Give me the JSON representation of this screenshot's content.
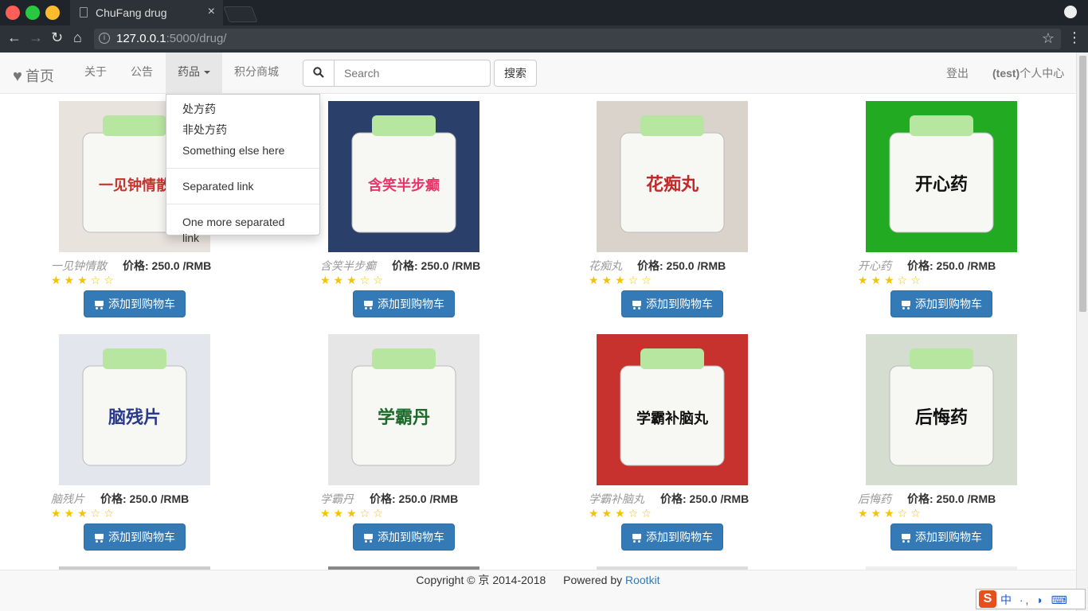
{
  "browser": {
    "tab_title": "ChuFang drug",
    "close_glyph": "×",
    "url_host": "127.0.0.1",
    "url_path": ":5000/drug/",
    "colors": {
      "frame": "#1e2429",
      "close": "#ff5f57",
      "minimize": "#28c840",
      "maximize": "#ffbd2e"
    }
  },
  "navbar": {
    "brand": "首页",
    "items": [
      {
        "label": "关于"
      },
      {
        "label": "公告"
      },
      {
        "label": "药品"
      },
      {
        "label": "积分商城"
      }
    ],
    "search_placeholder": "Search",
    "search_button": "搜索",
    "logout": "登出",
    "user_prefix": "(test)",
    "user_center": "个人中心"
  },
  "dropdown": {
    "items": [
      "处方药",
      "非处方药",
      "Something else here",
      "Separated link",
      "One more separated link"
    ]
  },
  "products": [
    {
      "name": "一见钟情散",
      "price": "价格: 250.0 /RMB",
      "rating": 3,
      "button": "添加到购物车",
      "img_text": "一见钟情散",
      "img_color": "#c8322e",
      "bg": "#e9e3de"
    },
    {
      "name": "含笑半步癫",
      "price": "价格: 250.0 /RMB",
      "rating": 3,
      "button": "添加到购物车",
      "img_text": "含笑半步癫",
      "img_color": "#e8366b",
      "bg": "#2a3f6a"
    },
    {
      "name": "花痴丸",
      "price": "价格: 250.0 /RMB",
      "rating": 3,
      "button": "添加到购物车",
      "img_text": "花痴丸",
      "img_color": "#c22a2a",
      "bg": "#d9d3cc"
    },
    {
      "name": "开心药",
      "price": "价格: 250.0 /RMB",
      "rating": 3,
      "button": "添加到购物车",
      "img_text": "开心药",
      "img_color": "#111111",
      "bg": "#22aa22"
    },
    {
      "name": "脑残片",
      "price": "价格: 250.0 /RMB",
      "rating": 3,
      "button": "添加到购物车",
      "img_text": "脑残片",
      "img_color": "#2a3a8a",
      "bg": "#e4e6ee"
    },
    {
      "name": "学霸丹",
      "price": "价格: 250.0 /RMB",
      "rating": 3,
      "button": "添加到购物车",
      "img_text": "学霸丹",
      "img_color": "#1e6a2a",
      "bg": "#e6e6e6"
    },
    {
      "name": "学霸补脑丸",
      "price": "价格: 250.0 /RMB",
      "rating": 3,
      "button": "添加到购物车",
      "img_text": "学霸补脑丸",
      "img_color": "#111111",
      "bg": "#c8322e"
    },
    {
      "name": "后悔药",
      "price": "价格: 250.0 /RMB",
      "rating": 3,
      "button": "添加到购物车",
      "img_text": "后悔药",
      "img_color": "#111111",
      "bg": "#d5dcd0"
    }
  ],
  "footer": {
    "copyright": "Copyright © 京 2014-2018",
    "powered": "Powered by",
    "link": "Rootkit"
  },
  "ime": {
    "logo": "S",
    "text": "中 ·, ◗ ⌨"
  }
}
